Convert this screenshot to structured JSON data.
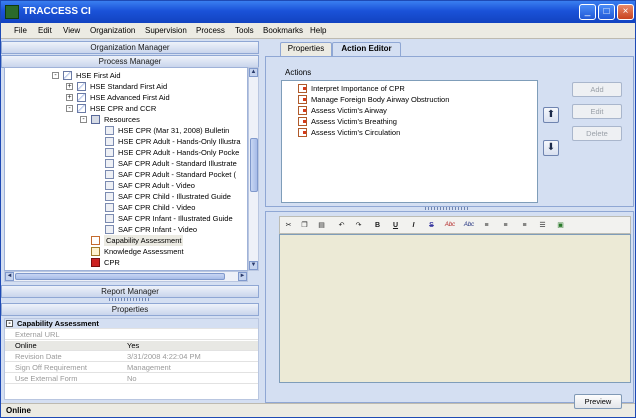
{
  "window": {
    "title": "TRACCESS CI"
  },
  "menu": [
    "File",
    "Edit",
    "View",
    "Organization",
    "Supervision",
    "Process",
    "Tools",
    "Bookmarks",
    "Help"
  ],
  "left": {
    "organization_manager": "Organization Manager",
    "process_manager": "Process Manager",
    "report_manager": "Report Manager",
    "properties_header": "Properties"
  },
  "tree": [
    {
      "label": "HSE  First Aid",
      "level": 0,
      "expander": "-",
      "icon": "course-icon"
    },
    {
      "label": "HSE  Standard First Aid",
      "level": 1,
      "expander": "+",
      "icon": "course-icon"
    },
    {
      "label": "HSE  Advanced First Aid",
      "level": 1,
      "expander": "+",
      "icon": "course-icon"
    },
    {
      "label": "HSE  CPR and CCR",
      "level": 1,
      "expander": "-",
      "icon": "course-icon"
    },
    {
      "label": "Resources",
      "level": 2,
      "expander": "-",
      "icon": "resources-icon"
    },
    {
      "label": "HSE  CPR (Mar 31, 2008) Bulletin",
      "level": 3,
      "icon": "document-icon"
    },
    {
      "label": "HSE  CPR Adult - Hands-Only Illustra",
      "level": 3,
      "icon": "document-icon"
    },
    {
      "label": "HSE  CPR Adult - Hands-Only Pocke",
      "level": 3,
      "icon": "document-icon"
    },
    {
      "label": "SAF  CPR Adult - Standard Illustrate",
      "level": 3,
      "icon": "document-icon"
    },
    {
      "label": "SAF  CPR Adult - Standard Pocket (",
      "level": 3,
      "icon": "document-icon"
    },
    {
      "label": "SAF  CPR Adult - Video",
      "level": 3,
      "icon": "document-icon"
    },
    {
      "label": "SAF  CPR Child - Illustrated Guide",
      "level": 3,
      "icon": "document-icon"
    },
    {
      "label": "SAF  CPR Child - Video",
      "level": 3,
      "icon": "document-icon"
    },
    {
      "label": "SAF  CPR Infant - Illustrated Guide",
      "level": 3,
      "icon": "document-icon"
    },
    {
      "label": "SAF  CPR Infant - Video",
      "level": 3,
      "icon": "document-icon"
    },
    {
      "label": "Capability Assessment",
      "level": 2,
      "icon": "capability-icon",
      "selected": true
    },
    {
      "label": "Knowledge Assessment",
      "level": 2,
      "icon": "knowledge-icon"
    },
    {
      "label": "CPR",
      "level": 2,
      "icon": "cpr-icon"
    }
  ],
  "properties": {
    "section": "Capability Assessment",
    "rows": [
      {
        "key": "External URL",
        "value": ""
      },
      {
        "key": "Online",
        "value": "Yes",
        "active": true
      },
      {
        "key": "Revision Date",
        "value": "3/31/2008 4:22:04 PM"
      },
      {
        "key": "Sign Off Requirement",
        "value": "Management"
      },
      {
        "key": "Use External Form",
        "value": "No"
      }
    ]
  },
  "status": "Online",
  "tabs": [
    {
      "label": "Properties"
    },
    {
      "label": "Action Editor",
      "active": true
    }
  ],
  "actions": {
    "label": "Actions",
    "items": [
      "Interpret Importance of CPR",
      "Manage Foreign Body Airway Obstruction",
      "Assess Victim's Airway",
      "Assess Victim's Breathing",
      "Assess Victim's Circulation"
    ],
    "add_label": "Add",
    "edit_label": "Edit",
    "delete_label": "Delete"
  },
  "toolbar_icons": [
    "cut-icon",
    "copy-icon",
    "paste-icon",
    "undo-icon",
    "redo-icon",
    "bold-icon",
    "underline-icon",
    "italic-icon",
    "strikethrough-icon",
    "spellcheck-icon",
    "spellcheck-as-you-type-icon",
    "align-left-icon",
    "align-center-icon",
    "align-right-icon",
    "bulleted-list-icon",
    "insert-image-icon"
  ],
  "toolbar_glyphs": {
    "bold": "B",
    "underline": "U",
    "italic": "I",
    "strike": "S",
    "abc1": "Abc",
    "abc2": "Abc"
  },
  "preview_label": "Preview",
  "colors": {
    "titlebar": "#1a52d8",
    "panel": "#d4dff2",
    "editor_bg": "#ecead6"
  }
}
